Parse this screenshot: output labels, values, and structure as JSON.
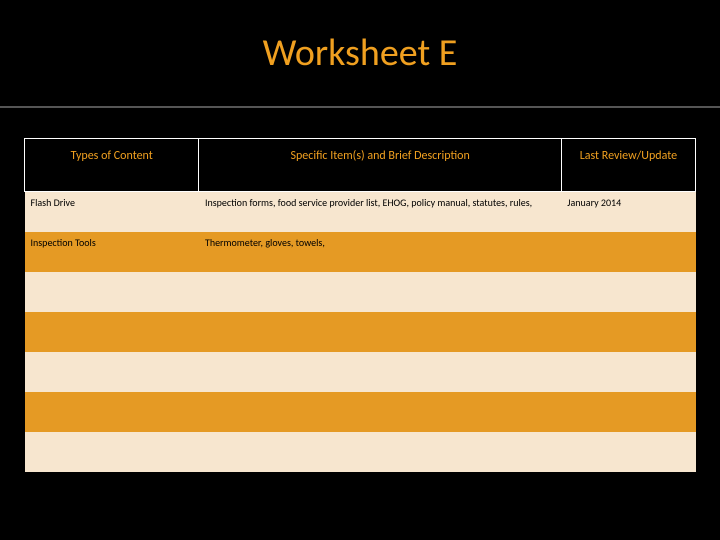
{
  "title": "Worksheet E",
  "table": {
    "headers": {
      "type": "Types of Content",
      "desc": "Specific Item(s) and Brief Description",
      "date": "Last Review/Update"
    },
    "rows": [
      {
        "type": "Flash Drive",
        "desc": "Inspection forms, food service provider list, EHOG, policy manual, statutes, rules,",
        "date": "January 2014"
      },
      {
        "type": "Inspection Tools",
        "desc": "Thermometer, gloves, towels,",
        "date": ""
      },
      {
        "type": "",
        "desc": "",
        "date": ""
      },
      {
        "type": "",
        "desc": "",
        "date": ""
      },
      {
        "type": "",
        "desc": "",
        "date": ""
      },
      {
        "type": "",
        "desc": "",
        "date": ""
      },
      {
        "type": "",
        "desc": "",
        "date": ""
      }
    ]
  }
}
